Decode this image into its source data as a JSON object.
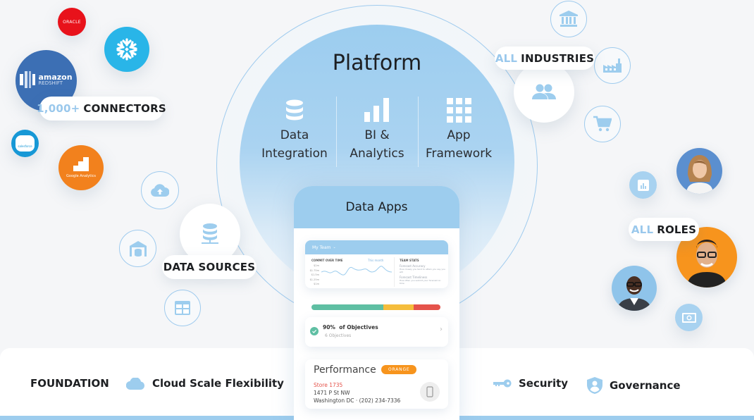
{
  "platform": {
    "title": "Platform",
    "pillars": [
      {
        "icon": "database-icon",
        "line1": "Data",
        "line2": "Integration"
      },
      {
        "icon": "bar-chart-icon",
        "line1": "BI &",
        "line2": "Analytics"
      },
      {
        "icon": "grid-icon",
        "line1": "App",
        "line2": "Framework"
      }
    ]
  },
  "connectors": {
    "pill_accent": "1,000+",
    "pill_label": "CONNECTORS",
    "logos": [
      {
        "name": "Oracle",
        "text": "ORACLE",
        "color": "#e8121b"
      },
      {
        "name": "Snowflake",
        "color": "#29b5e8"
      },
      {
        "name": "Amazon Redshift",
        "line1": "amazon",
        "line2": "REDSHIFT",
        "color": "#3c6fb4"
      },
      {
        "name": "Salesforce",
        "text": "salesforce",
        "color": "#1798d6"
      },
      {
        "name": "Google Analytics",
        "text": "Google Analytics",
        "color": "#f2811d"
      }
    ]
  },
  "data_sources": {
    "label": "DATA SOURCES",
    "icons": [
      "cloud-upload-icon",
      "warehouse-icon",
      "table-icon",
      "database-network-icon"
    ]
  },
  "industries": {
    "pill_accent": "ALL",
    "pill_label": "INDUSTRIES",
    "icons": [
      "bank-icon",
      "factory-icon",
      "cart-icon",
      "users-icon"
    ]
  },
  "roles": {
    "pill_accent": "ALL",
    "pill_label": "ROLES",
    "icons": [
      "report-icon",
      "money-icon"
    ]
  },
  "data_apps": {
    "title": "Data Apps",
    "team_card": {
      "header": "My Team",
      "chart_title": "COMMIT OVER TIME",
      "chart_filter": "This month",
      "y_ticks": [
        "$2m",
        "$1.75m",
        "$1.5m",
        "$1.25m",
        "$1m"
      ],
      "stats_title": "TEAM STATS",
      "stat1_title": "Forecast Accuracy",
      "stat1_desc": "How closely you tend to attain you say you will",
      "stat2_title": "Forecast Timeliness",
      "stat2_desc": "How often you submit your forecast on time"
    },
    "progress": {
      "segments": [
        {
          "fraction": 0.56,
          "color": "#5fbfa3"
        },
        {
          "fraction": 0.23,
          "color": "#f5bd3c"
        },
        {
          "fraction": 0.21,
          "color": "#e5534b"
        }
      ]
    },
    "objectives": {
      "percent": "90%",
      "label": "of Objectives",
      "sub": "6 Objectives"
    },
    "performance": {
      "title": "Performance",
      "badge": "ORANGE",
      "store": "Store 1735",
      "address1": "1471 P St NW",
      "address2": "Washington DC · (202) 234-7336"
    }
  },
  "foundation": {
    "label": "FOUNDATION",
    "items": [
      {
        "icon": "cloud-icon",
        "label": "Cloud Scale Flexibility"
      },
      {
        "icon": "key-icon",
        "label": "Security"
      },
      {
        "icon": "shield-user-icon",
        "label": "Governance"
      }
    ]
  },
  "colors": {
    "accent": "#9dcdee",
    "background": "#f5f6f8",
    "text": "#1d1f22",
    "orange": "#f7941d"
  }
}
